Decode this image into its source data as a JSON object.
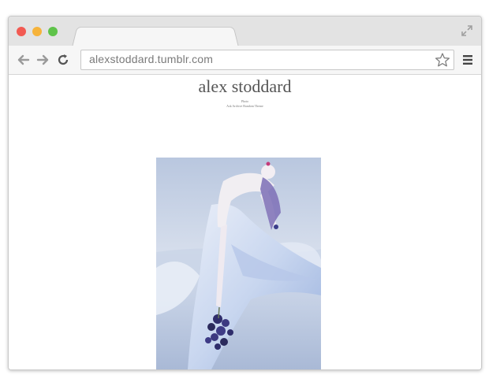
{
  "browser": {
    "url": "alexstoddard.tumblr.com",
    "icons": {
      "back": "arrow-left-icon",
      "forward": "arrow-right-icon",
      "reload": "reload-icon",
      "bookmark": "star-icon",
      "menu": "hamburger-menu-icon",
      "fullscreen": "expand-icon"
    },
    "colors": {
      "close": "#f25a52",
      "minimize": "#f6b33b",
      "maximize": "#5fc34a"
    }
  },
  "page": {
    "title": "alex stoddard",
    "subtitle": "Photo",
    "nav": "Ask Archive Random Theme"
  }
}
